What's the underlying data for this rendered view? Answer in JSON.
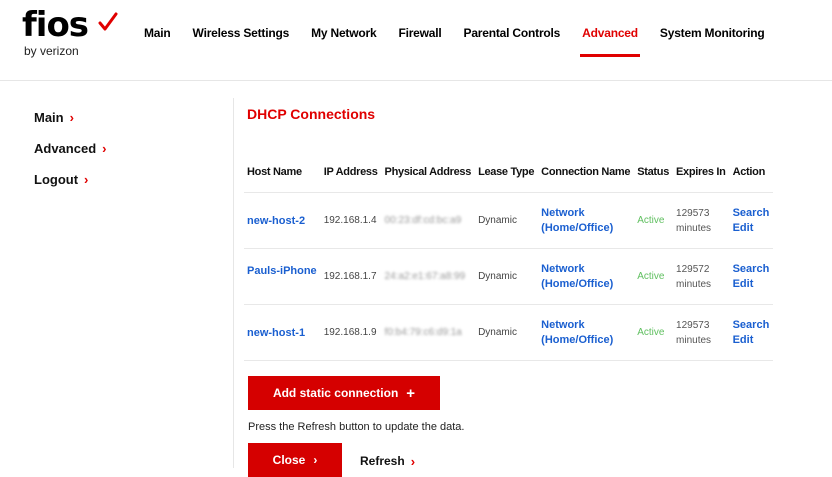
{
  "brand": {
    "wordmark": "fios",
    "tagline": "by verizon",
    "accent_color": "#e00000"
  },
  "topnav": [
    {
      "label": "Main",
      "active": false
    },
    {
      "label": "Wireless Settings",
      "active": false
    },
    {
      "label": "My Network",
      "active": false
    },
    {
      "label": "Firewall",
      "active": false
    },
    {
      "label": "Parental Controls",
      "active": false
    },
    {
      "label": "Advanced",
      "active": true
    },
    {
      "label": "System Monitoring",
      "active": false
    }
  ],
  "sidebar": {
    "items": [
      {
        "label": "Main"
      },
      {
        "label": "Advanced"
      },
      {
        "label": "Logout"
      }
    ]
  },
  "main": {
    "title": "DHCP Connections",
    "columns": [
      "Host Name",
      "IP Address",
      "Physical Address",
      "Lease Type",
      "Connection Name",
      "Status",
      "Expires In",
      "Action"
    ],
    "rows": [
      {
        "host": "new-host-2",
        "ip": "192.168.1.4",
        "mac": "00:23:df:cd:bc:a9",
        "lease": "Dynamic",
        "conn_line1": "Network",
        "conn_line2": "(Home/Office)",
        "status": "Active",
        "expires_value": "129573",
        "expires_unit": "minutes",
        "action_search": "Search",
        "action_edit": "Edit"
      },
      {
        "host": "Pauls-iPhone",
        "ip": "192.168.1.7",
        "mac": "24:a2:e1:67:a8:99",
        "lease": "Dynamic",
        "conn_line1": "Network",
        "conn_line2": "(Home/Office)",
        "status": "Active",
        "expires_value": "129572",
        "expires_unit": "minutes",
        "action_search": "Search",
        "action_edit": "Edit"
      },
      {
        "host": "new-host-1",
        "ip": "192.168.1.9",
        "mac": "f0:b4:79:c6:d9:1a",
        "lease": "Dynamic",
        "conn_line1": "Network",
        "conn_line2": "(Home/Office)",
        "status": "Active",
        "expires_value": "129573",
        "expires_unit": "minutes",
        "action_search": "Search",
        "action_edit": "Edit"
      }
    ],
    "add_button": "Add static connection",
    "note": "Press the Refresh button to update the data.",
    "close_button": "Close",
    "refresh_link": "Refresh"
  }
}
